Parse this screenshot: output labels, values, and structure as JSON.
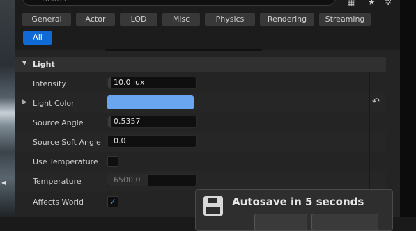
{
  "search": {
    "placeholder": "Search"
  },
  "toolbar_icons": [
    "grid-icon",
    "star-icon",
    "gear-icon"
  ],
  "filters": [
    {
      "label": "General",
      "active": false
    },
    {
      "label": "Actor",
      "active": false
    },
    {
      "label": "LOD",
      "active": false
    },
    {
      "label": "Misc",
      "active": false
    },
    {
      "label": "Physics",
      "active": false
    },
    {
      "label": "Rendering",
      "active": false
    },
    {
      "label": "Streaming",
      "active": false
    },
    {
      "label": "All",
      "active": true
    }
  ],
  "section": {
    "title": "Light"
  },
  "properties": [
    {
      "label": "Intensity",
      "value": "10.0 lux"
    },
    {
      "label": "Light Color",
      "color": "#6aa6ef"
    },
    {
      "label": "Source Angle",
      "value": "0.5357"
    },
    {
      "label": "Source Soft Angle",
      "value": "0.0"
    },
    {
      "label": "Use Temperature",
      "checked": false
    },
    {
      "label": "Temperature",
      "value": "6500.0"
    },
    {
      "label": "Affects World",
      "checked": true
    }
  ],
  "toast": {
    "message": "Autosave in 5 seconds"
  },
  "colors": {
    "accent": "#0f6ad6",
    "panel": "#242424",
    "light_color": "#6aa6ef"
  }
}
